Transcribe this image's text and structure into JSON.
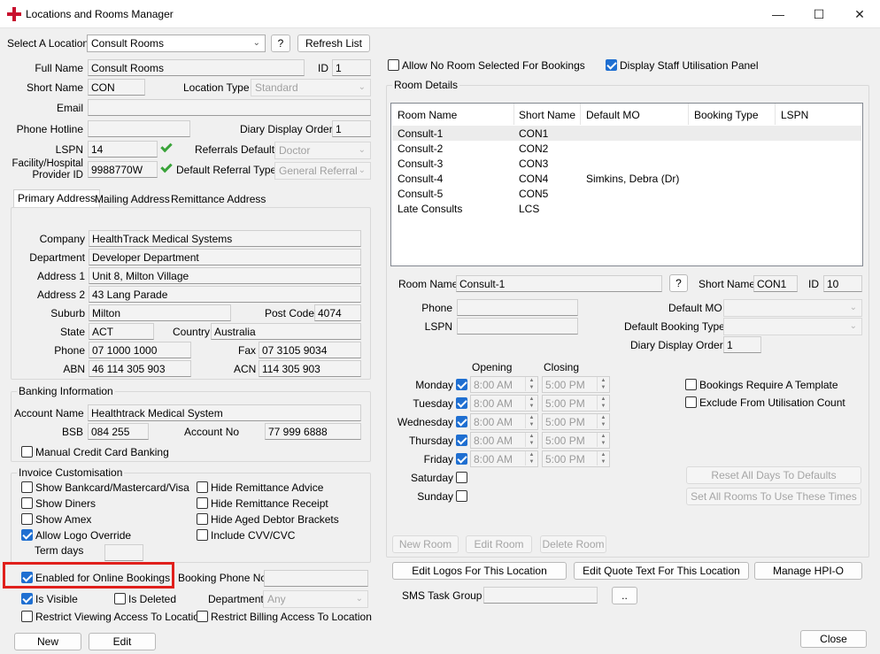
{
  "window": {
    "title": "Locations and Rooms Manager",
    "controls": {
      "minimize": "—",
      "maximize": "☐",
      "close": "✕"
    }
  },
  "location": {
    "select_label": "Select A Location",
    "selected": "Consult Rooms",
    "help_label": "?",
    "refresh_label": "Refresh List"
  },
  "details": {
    "full_name_label": "Full Name",
    "full_name": "Consult Rooms",
    "id_label": "ID",
    "id": "1",
    "short_name_label": "Short Name",
    "short_name": "CON",
    "location_type_label": "Location Type",
    "location_type": "Standard",
    "email_label": "Email",
    "email": "",
    "phone_hotline_label": "Phone Hotline",
    "phone_hotline": "",
    "diary_order_label": "Diary Display Order",
    "diary_order": "1",
    "lspn_label": "LSPN",
    "lspn": "14",
    "referrals_default_label": "Referrals Default",
    "referrals_default": "Doctor",
    "provider_id_label_1": "Facility/Hospital",
    "provider_id_label_2": "Provider ID",
    "provider_id": "9988770W",
    "default_referral_type_label": "Default Referral Type",
    "default_referral_type": "General Referral"
  },
  "tabs": [
    "Primary Address",
    "Mailing Address",
    "Remittance Address"
  ],
  "address": {
    "company_label": "Company",
    "company": "HealthTrack Medical Systems",
    "department_label": "Department",
    "department": "Developer Department",
    "address1_label": "Address 1",
    "address1": "Unit 8, Milton Village",
    "address2_label": "Address 2",
    "address2": "43 Lang Parade",
    "suburb_label": "Suburb",
    "suburb": "Milton",
    "postcode_label": "Post Code",
    "postcode": "4074",
    "state_label": "State",
    "state": "ACT",
    "country_label": "Country",
    "country": "Australia",
    "phone_label": "Phone",
    "phone": "07 1000 1000",
    "fax_label": "Fax",
    "fax": "07 3105 9034",
    "abn_label": "ABN",
    "abn": "46 114 305 903",
    "acn_label": "ACN",
    "acn": "114 305 903"
  },
  "banking": {
    "title": "Banking Information",
    "account_name_label": "Account Name",
    "account_name": "Healthtrack Medical System",
    "bsb_label": "BSB",
    "bsb": "084 255",
    "account_no_label": "Account No",
    "account_no": "77 999 6888",
    "manual_cc_label": "Manual Credit Card Banking"
  },
  "invoice": {
    "title": "Invoice Customisation",
    "show_bankcard": "Show Bankcard/Mastercard/Visa",
    "show_diners": "Show Diners",
    "show_amex": "Show Amex",
    "allow_logo": "Allow Logo Override",
    "hide_remit_advice": "Hide Remittance Advice",
    "hide_remit_receipt": "Hide Remittance Receipt",
    "hide_aged": "Hide Aged Debtor Brackets",
    "include_cvv": "Include CVV/CVC",
    "term_days_label": "Term days",
    "term_days": ""
  },
  "bottom": {
    "online_bookings": "Enabled for Online Bookings",
    "booking_phone_label": "Booking Phone No",
    "booking_phone": "",
    "is_visible": "Is Visible",
    "is_deleted": "Is Deleted",
    "department_label": "Department",
    "department": "Any",
    "restrict_viewing": "Restrict Viewing Access To Location",
    "restrict_billing": "Restrict Billing Access To Location",
    "new_label": "New",
    "edit_label": "Edit"
  },
  "right": {
    "allow_no_room": "Allow No Room Selected For Bookings",
    "display_staff": "Display Staff Utilisation Panel",
    "room_details_title": "Room Details"
  },
  "rooms_table": {
    "columns": [
      "Room Name",
      "Short Name",
      "Default MO",
      "Booking Type",
      "LSPN"
    ],
    "rows": [
      {
        "name": "Consult-1",
        "short": "CON1",
        "mo": "",
        "type": "",
        "lspn": ""
      },
      {
        "name": "Consult-2",
        "short": "CON2",
        "mo": "",
        "type": "",
        "lspn": ""
      },
      {
        "name": "Consult-3",
        "short": "CON3",
        "mo": "",
        "type": "",
        "lspn": ""
      },
      {
        "name": "Consult-4",
        "short": "CON4",
        "mo": "Simkins, Debra (Dr)",
        "type": "",
        "lspn": ""
      },
      {
        "name": "Consult-5",
        "short": "CON5",
        "mo": "",
        "type": "",
        "lspn": ""
      },
      {
        "name": "Late Consults",
        "short": "LCS",
        "mo": "",
        "type": "",
        "lspn": ""
      }
    ]
  },
  "room": {
    "room_name_label": "Room Name",
    "room_name": "Consult-1",
    "help_label": "?",
    "short_name_label": "Short Name",
    "short_name": "CON1",
    "id_label": "ID",
    "id": "10",
    "phone_label": "Phone",
    "phone": "",
    "default_mo_label": "Default MO",
    "default_mo": "",
    "lspn_label": "LSPN",
    "lspn": "",
    "default_booking_type_label": "Default Booking Type",
    "default_booking_type": "",
    "diary_order_label": "Diary Display Order",
    "diary_order": "1"
  },
  "schedule": {
    "opening_label": "Opening",
    "closing_label": "Closing",
    "days": [
      {
        "day": "Monday",
        "open": "8:00 AM",
        "close": "5:00 PM"
      },
      {
        "day": "Tuesday",
        "open": "8:00 AM",
        "close": "5:00 PM"
      },
      {
        "day": "Wednesday",
        "open": "8:00 AM",
        "close": "5:00 PM"
      },
      {
        "day": "Thursday",
        "open": "8:00 AM",
        "close": "5:00 PM"
      },
      {
        "day": "Friday",
        "open": "8:00 AM",
        "close": "5:00 PM"
      },
      {
        "day": "Saturday",
        "open": "",
        "close": ""
      },
      {
        "day": "Sunday",
        "open": "",
        "close": ""
      }
    ],
    "requires_template": "Bookings Require A Template",
    "exclude_util": "Exclude From Utilisation Count",
    "reset_days": "Reset All Days To Defaults",
    "set_all_rooms": "Set All Rooms To Use These Times"
  },
  "room_actions": {
    "new_room": "New Room",
    "edit_room": "Edit Room",
    "delete_room": "Delete Room"
  },
  "location_actions": {
    "edit_logos": "Edit Logos For This Location",
    "edit_quote": "Edit Quote Text For This Location",
    "manage_hpio": "Manage HPI-O",
    "sms_task_group_label": "SMS Task Group",
    "sms_task_group": "",
    "ellipsis": "..",
    "close_label": "Close"
  }
}
